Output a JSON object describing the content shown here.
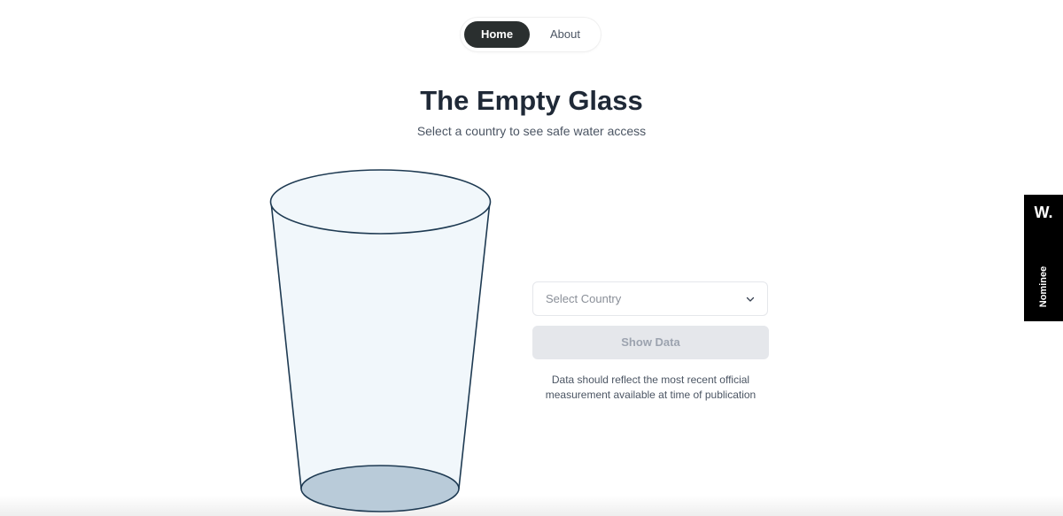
{
  "nav": {
    "items": [
      {
        "label": "Home",
        "active": true
      },
      {
        "label": "About",
        "active": false
      }
    ]
  },
  "header": {
    "title": "The Empty Glass",
    "subtitle": "Select a country to see safe water access"
  },
  "glass": {
    "fill_color": "#f1f7fb",
    "stroke_color": "#1e3a52",
    "bottom_color": "#b9cbd9",
    "water_level_fraction": 0
  },
  "form": {
    "country_select": {
      "placeholder": "Select Country",
      "icon": "chevron-down-icon"
    },
    "show_button_label": "Show Data",
    "note": "Data should reflect the most recent official measurement available at time of publication"
  },
  "badge": {
    "logo": "W.",
    "label": "Nominee"
  },
  "colors": {
    "nav_active_bg": "#2a2f2f",
    "button_disabled_bg": "#e5e7eb",
    "badge_bg": "#000000"
  }
}
